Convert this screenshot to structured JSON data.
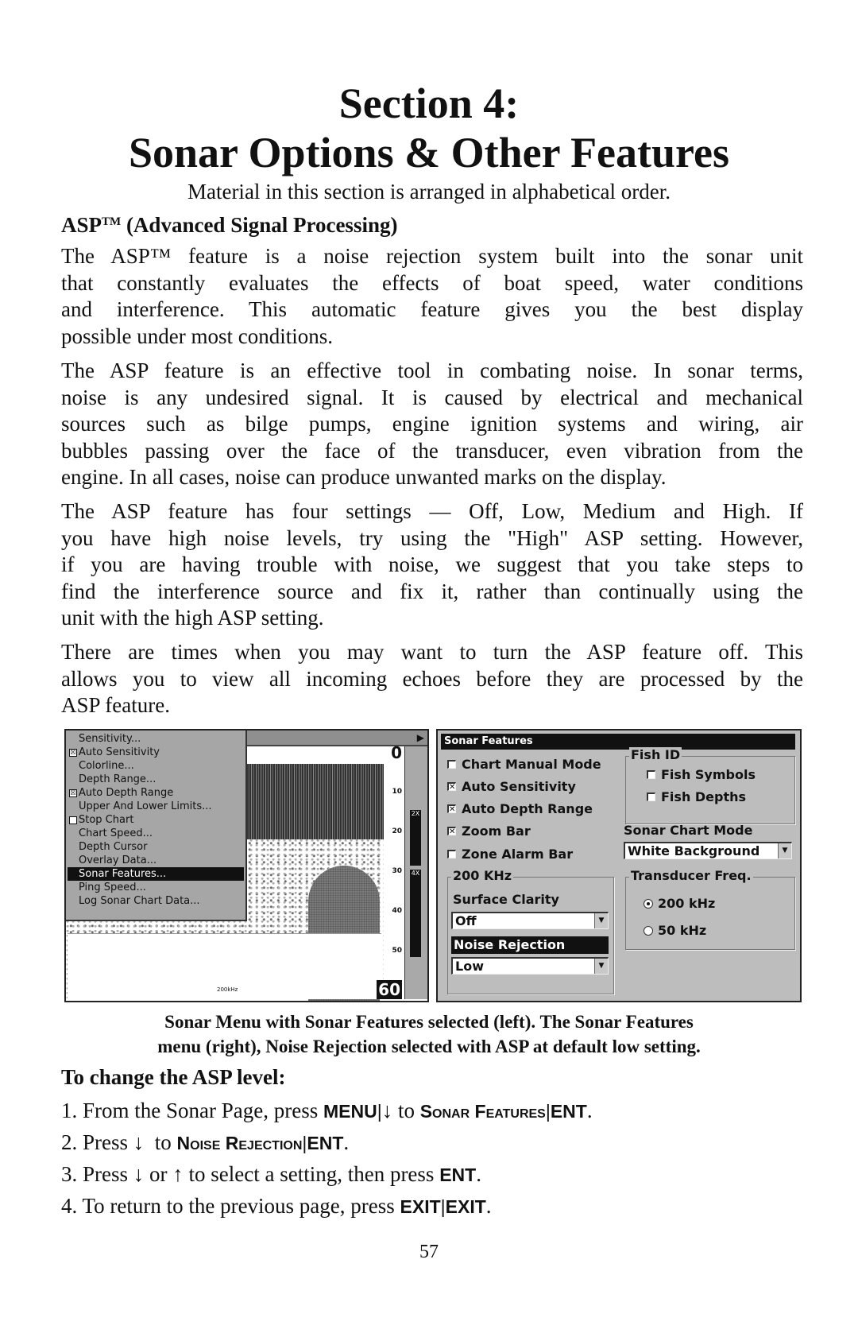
{
  "header": {
    "section_title": "Section 4:",
    "section_subtitle": "Sonar Options & Other Features",
    "intro": "Material in this section is arranged in alphabetical order."
  },
  "asp": {
    "heading_prefix": "ASP",
    "heading_tm": "TM",
    "heading_suffix": " (Advanced Signal Processing)",
    "p1": [
      "The ASP™ feature is a noise rejection system built into the sonar unit",
      "that constantly evaluates the effects of boat speed, water conditions",
      "and interference. This automatic feature gives you the best display",
      "possible under most conditions."
    ],
    "p2": [
      "The ASP feature is an effective tool in combating noise. In sonar terms,",
      "noise is any undesired signal. It is caused by electrical and mechanical",
      "sources such as bilge pumps, engine ignition systems and wiring, air",
      "bubbles passing over the face of the transducer, even vibration from the",
      "engine. In all cases, noise can produce unwanted marks on the display."
    ],
    "p3": [
      "The ASP feature has four settings — Off, Low, Medium and High. If",
      "you have high noise levels, try using the \"High\" ASP setting. However,",
      "if you are having trouble with noise, we suggest that you take steps to",
      "find the interference source and fix it, rather than continually using the",
      "unit with the high ASP setting."
    ],
    "p4": [
      "There are times when you may want to turn the ASP feature off. This",
      "allows you to view all incoming echoes before they are processed by the",
      "ASP feature."
    ]
  },
  "sonar_menu_screen": {
    "menu_items": [
      {
        "label": "Sensitivity...",
        "check": null,
        "selected": false
      },
      {
        "label": "Auto Sensitivity",
        "check": "checked",
        "selected": false
      },
      {
        "label": "Colorline...",
        "check": null,
        "selected": false
      },
      {
        "label": "Depth Range...",
        "check": null,
        "selected": false
      },
      {
        "label": "Auto Depth Range",
        "check": "checked",
        "selected": false
      },
      {
        "label": "Upper And Lower Limits...",
        "check": null,
        "selected": false
      },
      {
        "label": "Stop Chart",
        "check": "unchecked",
        "selected": false
      },
      {
        "label": "Chart Speed...",
        "check": null,
        "selected": false
      },
      {
        "label": "Depth Cursor",
        "check": null,
        "selected": false
      },
      {
        "label": "Overlay Data...",
        "check": null,
        "selected": false
      },
      {
        "label": "Sonar Features...",
        "check": null,
        "selected": true
      },
      {
        "label": "Ping Speed...",
        "check": null,
        "selected": false
      },
      {
        "label": "Log Sonar Chart Data...",
        "check": null,
        "selected": false
      }
    ],
    "depth_labels": [
      "0",
      "10",
      "20",
      "30",
      "40",
      "50",
      "60"
    ],
    "zoom_labels": [
      "2X",
      "4X"
    ],
    "frequency_label": "200kHz",
    "check_glyph": "☒",
    "arrow_glyph": "▶"
  },
  "sonar_features_screen": {
    "title": "Sonar Features",
    "checkboxes": [
      {
        "label": "Chart Manual Mode",
        "checked": false
      },
      {
        "label": "Auto Sensitivity",
        "checked": true
      },
      {
        "label": "Auto Depth Range",
        "checked": true
      },
      {
        "label": "Zoom Bar",
        "checked": true
      },
      {
        "label": "Zone Alarm Bar",
        "checked": false
      }
    ],
    "freq_group": {
      "label": "200 KHz",
      "surface_clarity_label": "Surface Clarity",
      "surface_clarity_value": "Off",
      "noise_rejection_label": "Noise Rejection",
      "noise_rejection_value": "Low"
    },
    "fish_id": {
      "label": "Fish ID",
      "options": [
        {
          "label": "Fish Symbols",
          "checked": false
        },
        {
          "label": "Fish Depths",
          "checked": false
        }
      ]
    },
    "chart_mode": {
      "label": "Sonar Chart Mode",
      "value": "White Background"
    },
    "transducer": {
      "label": "Transducer Freq.",
      "options": [
        {
          "label": "200 kHz",
          "selected": true
        },
        {
          "label": "50 kHz",
          "selected": false
        }
      ]
    },
    "dropdown_glyph": "▼",
    "check_glyph": "✕"
  },
  "caption": [
    "Sonar Menu with Sonar Features selected (left). The Sonar Features",
    "menu (right), Noise Rejection selected with ASP at default low setting."
  ],
  "procedure": {
    "heading": "To change the ASP level:",
    "step1": {
      "num": "1. ",
      "t1": "From the Sonar Page, press ",
      "k1": "MENU",
      "sep": "|",
      "arrow": "↓",
      "t2": " to ",
      "k2": "Sonar Features",
      "k3": "ENT",
      "end": "."
    },
    "step2": {
      "num": "2. ",
      "t1": "Press ",
      "arrow": "↓",
      "t2": "  to ",
      "k1": "Noise Rejection",
      "sep": "|",
      "k2": "ENT",
      "end": "."
    },
    "step3": {
      "num": "3. ",
      "t1": "Press ",
      "arrow_down": "↓",
      "t2": " or ",
      "arrow_up": "↑",
      "t3": " to select a setting, then press ",
      "k1": "ENT",
      "end": "."
    },
    "step4": {
      "num": "4. ",
      "t1": "To return to the previous page, press ",
      "k1": "EXIT",
      "sep": "|",
      "k2": "EXIT",
      "end": "."
    }
  },
  "page_number": "57"
}
